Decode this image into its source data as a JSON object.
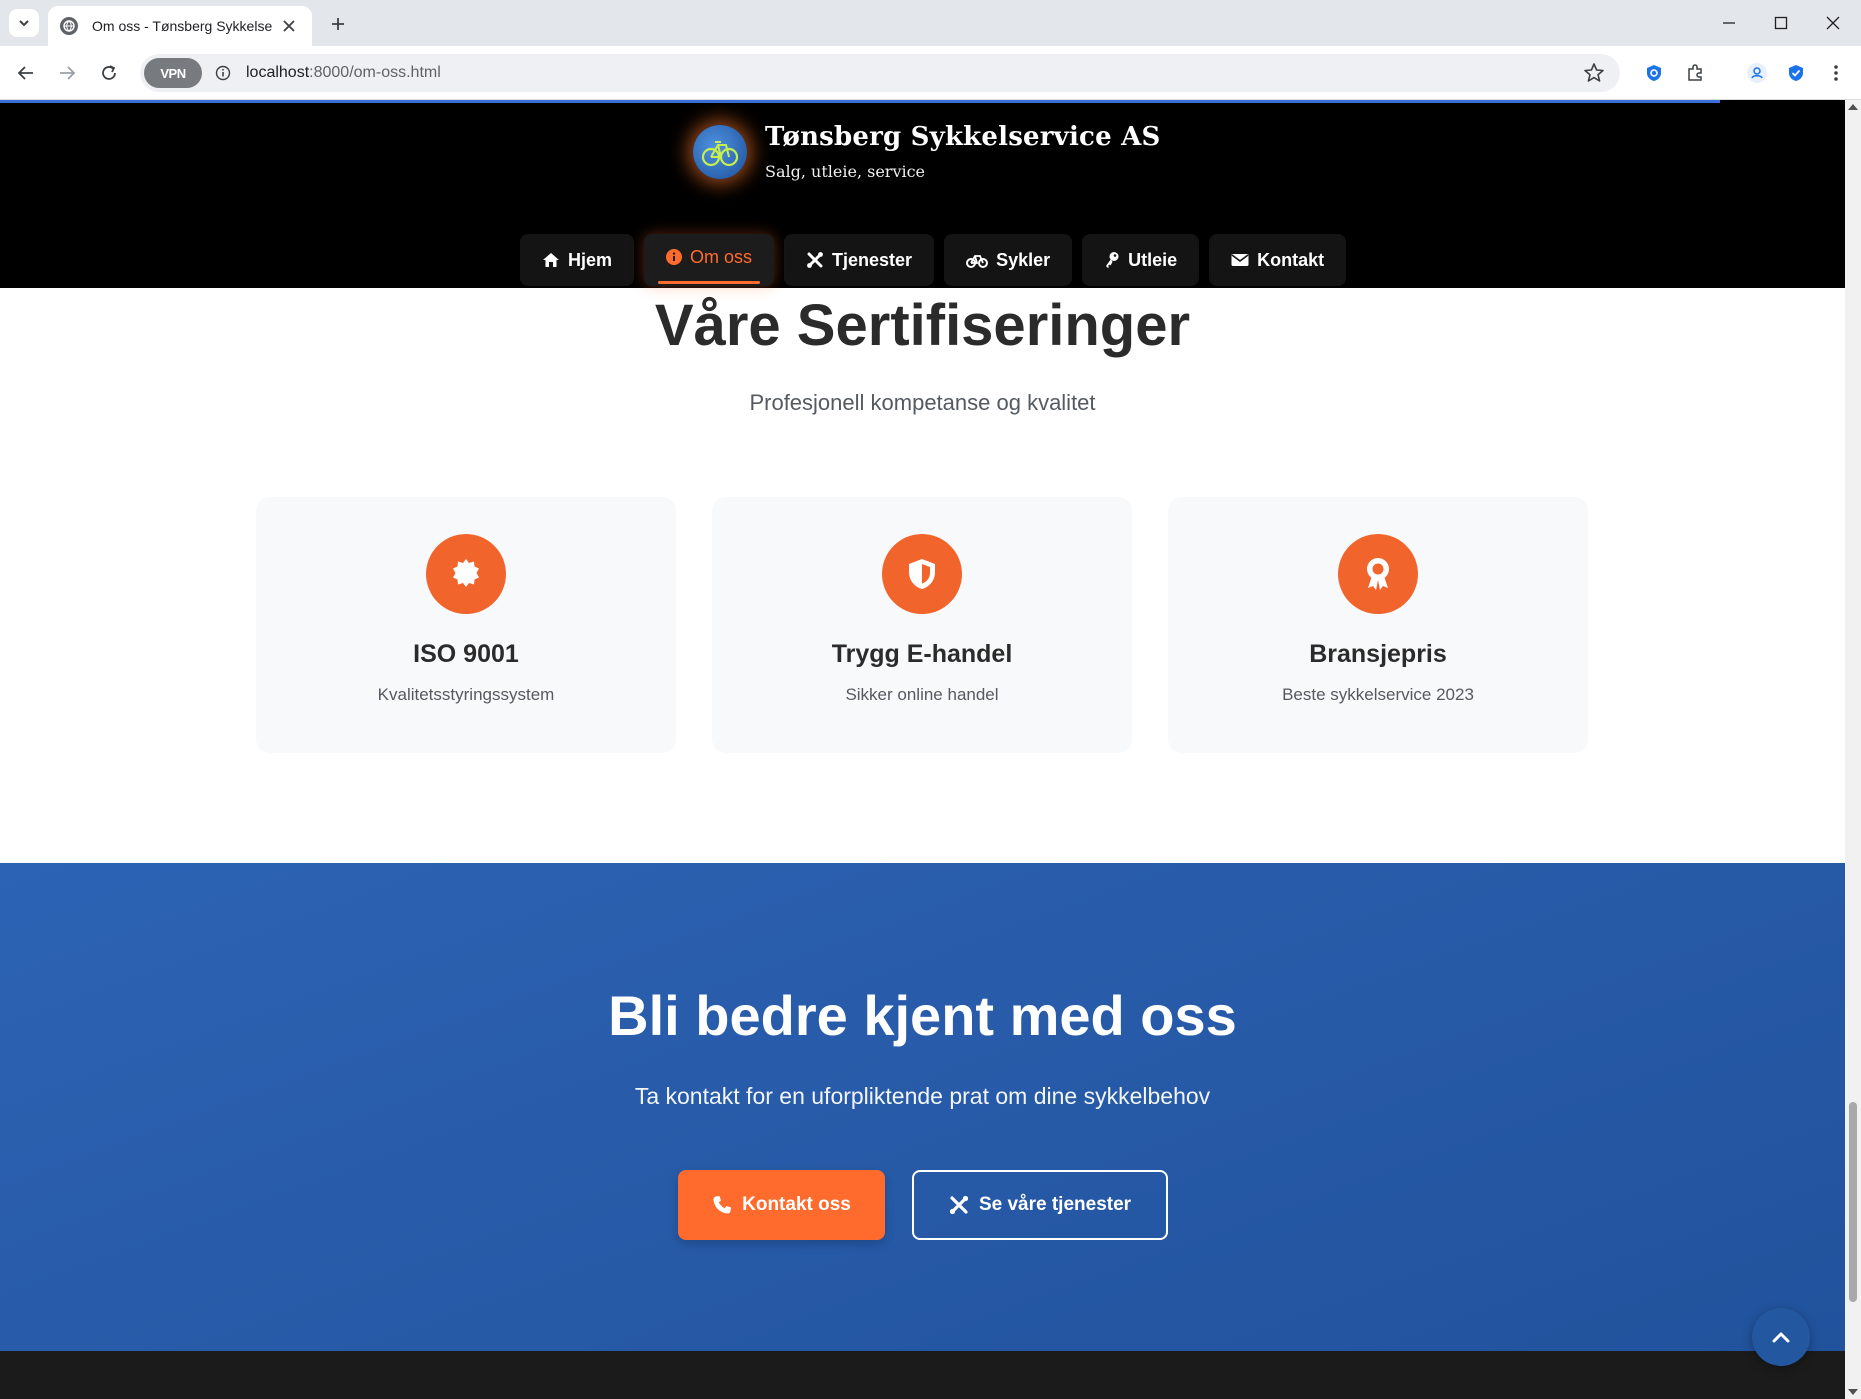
{
  "browser": {
    "tab_title": "Om oss - Tønsberg Sykkelservice AS",
    "url_host": "localhost",
    "url_path": ":8000/om-oss.html",
    "vpn_label": "VPN"
  },
  "site": {
    "brand_title": "Tønsberg Sykkelservice AS",
    "brand_subtitle": "Salg, utleie, service",
    "nav": [
      {
        "label": "Hjem",
        "icon": "home-icon"
      },
      {
        "label": "Om oss",
        "icon": "info-icon",
        "active": true
      },
      {
        "label": "Tjenester",
        "icon": "tools-icon"
      },
      {
        "label": "Sykler",
        "icon": "bicycle-icon"
      },
      {
        "label": "Utleie",
        "icon": "key-icon"
      },
      {
        "label": "Kontakt",
        "icon": "envelope-icon"
      }
    ]
  },
  "certifications": {
    "title": "Våre Sertifiseringer",
    "subtitle": "Profesjonell kompetanse og kvalitet",
    "cards": [
      {
        "title": "ISO 9001",
        "desc": "Kvalitetsstyringssystem",
        "icon": "certificate-icon"
      },
      {
        "title": "Trygg E-handel",
        "desc": "Sikker online handel",
        "icon": "shield-icon"
      },
      {
        "title": "Bransjepris",
        "desc": "Beste sykkelservice 2023",
        "icon": "award-icon"
      }
    ]
  },
  "cta": {
    "title": "Bli bedre kjent med oss",
    "subtitle": "Ta kontakt for en uforpliktende prat om dine sykkelbehov",
    "primary_label": "Kontakt oss",
    "secondary_label": "Se våre tjenester"
  },
  "colors": {
    "accent": "#ff6b2c",
    "header_bg": "#000000",
    "cta_bg": "#2d63b4",
    "footer_bg": "#1b1b1b"
  }
}
